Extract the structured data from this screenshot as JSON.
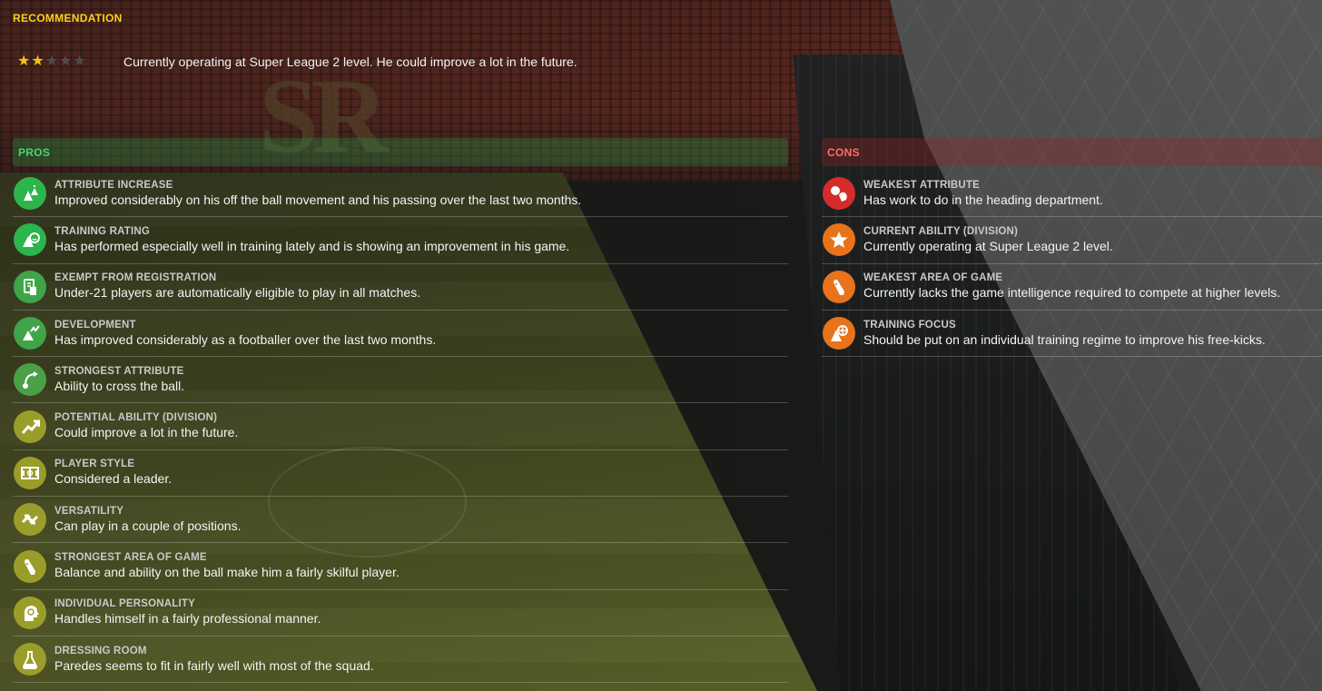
{
  "recommendation": {
    "title": "RECOMMENDATION",
    "stars_total": 5,
    "stars_filled": 2,
    "text": "Currently operating at Super League 2 level. He could improve a lot in the future."
  },
  "pros": {
    "label": "PROS",
    "items": [
      {
        "title": "ATTRIBUTE INCREASE",
        "desc": "Improved considerably on his off the ball movement and his passing over the last two months.",
        "icon": "attribute-increase-icon",
        "color": "#2bb54c"
      },
      {
        "title": "TRAINING RATING",
        "desc": "Has performed especially well in training lately and is showing an improvement in his game.",
        "icon": "training-rating-icon",
        "color": "#2bb54c"
      },
      {
        "title": "EXEMPT FROM REGISTRATION",
        "desc": "Under-21 players are automatically eligible to play in all matches.",
        "icon": "registration-icon",
        "color": "#3fa548"
      },
      {
        "title": "DEVELOPMENT",
        "desc": "Has improved considerably as a footballer over the last two months.",
        "icon": "development-icon",
        "color": "#3fa548"
      },
      {
        "title": "STRONGEST ATTRIBUTE",
        "desc": "Ability to cross the ball.",
        "icon": "cross-ball-icon",
        "color": "#4aa046"
      },
      {
        "title": "POTENTIAL ABILITY (DIVISION)",
        "desc": "Could improve a lot in the future.",
        "icon": "trend-up-icon",
        "color": "#9b9d2a"
      },
      {
        "title": "PLAYER STYLE",
        "desc": "Considered a leader.",
        "icon": "pitch-icon",
        "color": "#9b9d2a"
      },
      {
        "title": "VERSATILITY",
        "desc": "Can play in a couple of positions.",
        "icon": "swap-arrows-icon",
        "color": "#9b9d2a"
      },
      {
        "title": "STRONGEST AREA OF GAME",
        "desc": "Balance and ability on the ball make him a fairly skilful player.",
        "icon": "boot-icon",
        "color": "#9b9d2a"
      },
      {
        "title": "INDIVIDUAL PERSONALITY",
        "desc": "Handles himself in a fairly professional manner.",
        "icon": "head-icon",
        "color": "#9b9d2a"
      },
      {
        "title": "DRESSING ROOM",
        "desc": "Paredes seems to fit in fairly well with most of the squad.",
        "icon": "flask-icon",
        "color": "#9b9d2a"
      }
    ]
  },
  "cons": {
    "label": "CONS",
    "items": [
      {
        "title": "WEAKEST ATTRIBUTE",
        "desc": "Has work to do in the heading department.",
        "icon": "heading-icon",
        "color": "#d62b2b"
      },
      {
        "title": "CURRENT ABILITY (DIVISION)",
        "desc": "Currently operating at Super League 2 level.",
        "icon": "star-icon",
        "color": "#e8731a"
      },
      {
        "title": "WEAKEST AREA OF GAME",
        "desc": "Currently lacks the game intelligence required to compete at higher levels.",
        "icon": "boot-icon",
        "color": "#e8731a"
      },
      {
        "title": "TRAINING FOCUS",
        "desc": "Should be put on an individual training regime to improve his free-kicks.",
        "icon": "target-cone-icon",
        "color": "#e8731a"
      }
    ]
  }
}
